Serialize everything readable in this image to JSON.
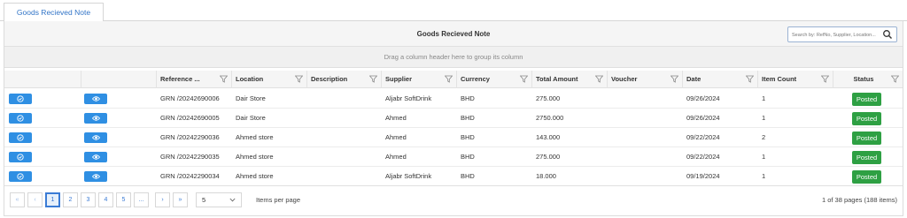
{
  "tab": {
    "label": "Goods Recieved Note"
  },
  "toolbar": {
    "title": "Goods Recieved Note"
  },
  "search": {
    "placeholder": "Search by: RefNo, Supplier, Location..."
  },
  "group_panel": {
    "text": "Drag a column header here to group its column"
  },
  "columns": [
    "Reference ...",
    "Location",
    "Description",
    "Supplier",
    "Currency",
    "Total Amount",
    "Voucher",
    "Date",
    "Item Count",
    "Status"
  ],
  "rows": [
    {
      "reference": "GRN /20242690006",
      "location": "Dair Store",
      "description": "",
      "supplier": "Aljabr SoftDrink",
      "currency": "BHD",
      "total": "275.000",
      "voucher": "",
      "date": "09/26/2024",
      "item_count": "1",
      "status": "Posted"
    },
    {
      "reference": "GRN /20242690005",
      "location": "Dair Store",
      "description": "",
      "supplier": "Ahmed",
      "currency": "BHD",
      "total": "2750.000",
      "voucher": "",
      "date": "09/26/2024",
      "item_count": "1",
      "status": "Posted"
    },
    {
      "reference": "GRN /20242290036",
      "location": "Ahmed store",
      "description": "",
      "supplier": "Ahmed",
      "currency": "BHD",
      "total": "143.000",
      "voucher": "",
      "date": "09/22/2024",
      "item_count": "2",
      "status": "Posted"
    },
    {
      "reference": "GRN /20242290035",
      "location": "Ahmed store",
      "description": "",
      "supplier": "Ahmed",
      "currency": "BHD",
      "total": "275.000",
      "voucher": "",
      "date": "09/22/2024",
      "item_count": "1",
      "status": "Posted"
    },
    {
      "reference": "GRN /20242290034",
      "location": "Ahmed store",
      "description": "",
      "supplier": "Aljabr SoftDrink",
      "currency": "BHD",
      "total": "18.000",
      "voucher": "",
      "date": "09/19/2024",
      "item_count": "1",
      "status": "Posted"
    }
  ],
  "pager": {
    "first": "«",
    "prev": "‹",
    "pages": [
      "1",
      "2",
      "3",
      "4",
      "5"
    ],
    "more": "...",
    "next": "›",
    "last": "»",
    "page_size": "5",
    "per_page_label": "Items per page",
    "info": "1 of 38 pages (188 items)"
  },
  "colors": {
    "accent": "#2f8fe3",
    "posted": "#2ea043",
    "link": "#3a7bd5"
  }
}
